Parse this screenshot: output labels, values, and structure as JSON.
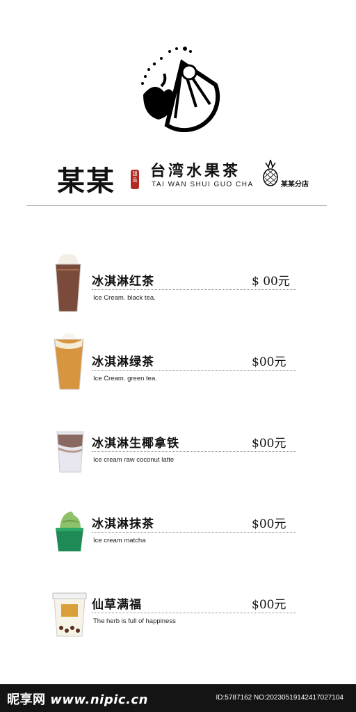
{
  "header": {
    "brand": "某某",
    "seal_text": "甜品",
    "subtitle_cn": "台湾水果茶",
    "subtitle_en": "TAI WAN SHUI GUO CHA",
    "branch": "某某分店",
    "logo_icon": "fruit-splash-logo-icon",
    "pineapple_icon": "pineapple-icon"
  },
  "menu": [
    {
      "name": "冰淇淋红茶",
      "desc": "Ice Cream. black tea.",
      "price": "$ 00元",
      "image": "black-tea-cup",
      "drink_color": "#7a4a3a"
    },
    {
      "name": "冰淇淋绿茶",
      "desc": "Ice Cream. green tea.",
      "price": "$00元",
      "image": "green-tea-cup",
      "drink_color": "#d89540"
    },
    {
      "name": "冰淇淋生椰拿铁",
      "desc": "Ice cream raw coconut latte",
      "price": "$00元",
      "image": "coconut-latte-cup",
      "drink_color": "#8a6a60"
    },
    {
      "name": "冰淇淋抹茶",
      "desc": "Ice cream matcha",
      "price": "$00元",
      "image": "matcha-cup",
      "drink_color": "#7fb35a"
    },
    {
      "name": "仙草满福",
      "desc": "The herb is full of happiness",
      "price": "$00元",
      "image": "herb-jelly-cup",
      "drink_color": "#d9c89a"
    }
  ],
  "footer": {
    "watermark": "昵享网",
    "site": "www.nipic.cn",
    "id_text": "ID:5787162 NO:20230519142417027104"
  }
}
